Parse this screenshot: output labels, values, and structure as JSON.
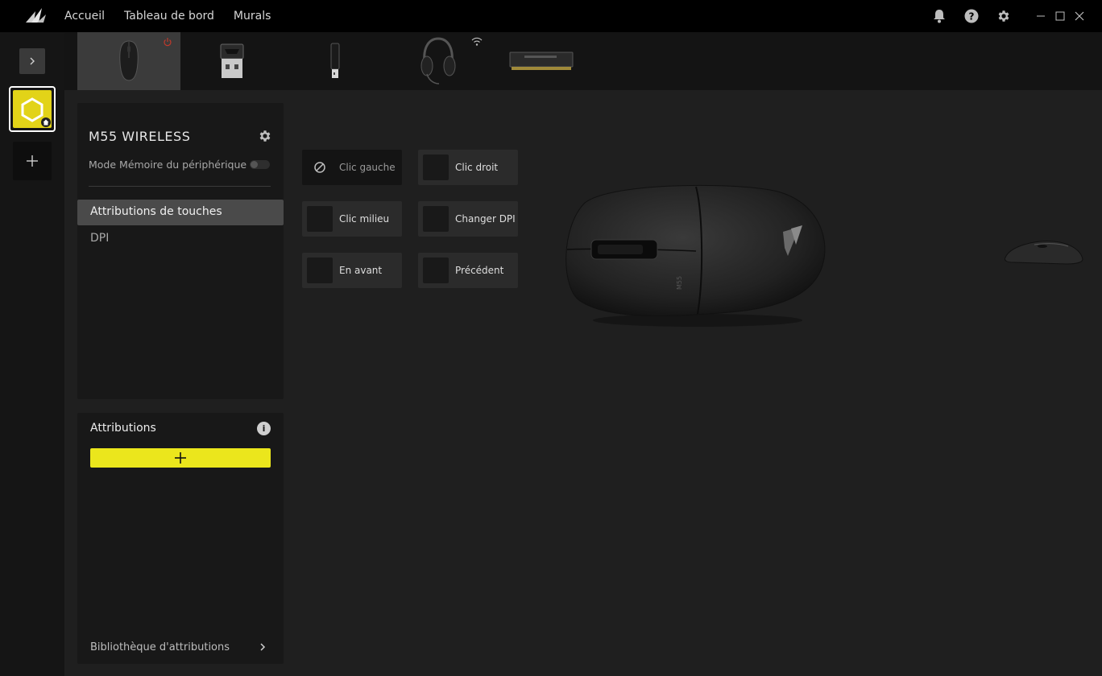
{
  "nav": {
    "items": [
      "Accueil",
      "Tableau de bord",
      "Murals"
    ]
  },
  "icons": {
    "logo": "corsair-sails-logo",
    "bell": "bell-icon",
    "help": "help-icon",
    "settings": "gear-icon",
    "minimize": "minimize-icon",
    "maximize": "maximize-icon",
    "close": "close-icon"
  },
  "devices": [
    {
      "name": "mouse",
      "active": true,
      "status": "power-icon"
    },
    {
      "name": "usb-receiver",
      "active": false
    },
    {
      "name": "usb-dongle",
      "active": false
    },
    {
      "name": "headset",
      "active": false,
      "status": "wireless-icon"
    },
    {
      "name": "memory-module",
      "active": false
    }
  ],
  "device_panel": {
    "title": "M55 WIRELESS",
    "memory_mode_label": "Mode Mémoire du périphérique",
    "memory_mode_on": false,
    "menu": [
      {
        "label": "Attributions de touches",
        "active": true
      },
      {
        "label": "DPI",
        "active": false
      }
    ]
  },
  "assignments_panel": {
    "title": "Attributions",
    "library_label": "Bibliothèque d'attributions"
  },
  "keys": [
    {
      "label": "Clic gauche",
      "selected": true
    },
    {
      "label": "Clic droit",
      "selected": false
    },
    {
      "label": "Clic milieu",
      "selected": false
    },
    {
      "label": "Changer DPI",
      "selected": false
    },
    {
      "label": "En avant",
      "selected": false
    },
    {
      "label": "Précédent",
      "selected": false
    }
  ],
  "colors": {
    "accent": "#ebe61c",
    "profile": "#e2d318",
    "power": "#c0392b"
  }
}
